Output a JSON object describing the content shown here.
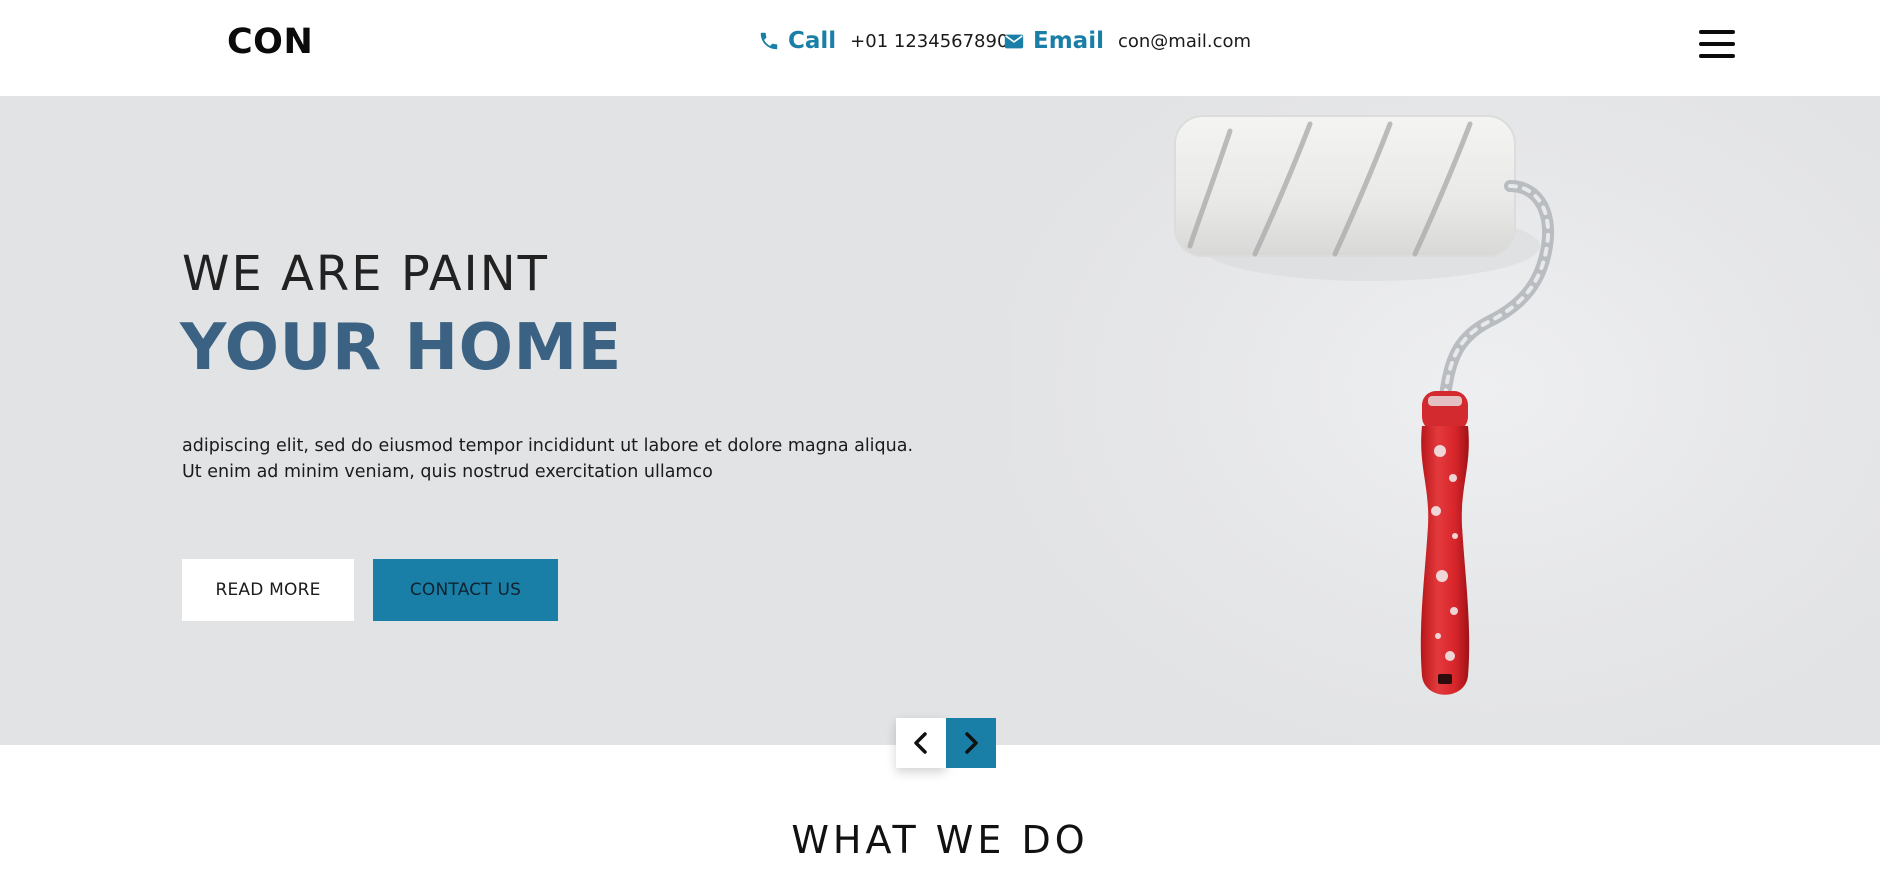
{
  "header": {
    "logo": "CON",
    "call_label": "Call",
    "call_value": "+01 1234567890",
    "email_label": "Email",
    "email_value": "con@mail.com",
    "icons": {
      "call": "phone-icon",
      "email": "envelope-icon",
      "menu": "hamburger-menu-icon"
    }
  },
  "hero": {
    "title_line1": "WE ARE PAINT",
    "title_line2": "YOUR HOME",
    "text_line1": "adipiscing elit, sed do eiusmod tempor incididunt ut labore et dolore magna aliqua.",
    "text_line2": "Ut enim ad minim veniam, quis nostrud exercitation ullamco",
    "read_more": "READ MORE",
    "contact_us": "CONTACT US",
    "image": "paint-roller-image"
  },
  "slider": {
    "prev_icon": "chevron-left-icon",
    "next_icon": "chevron-right-icon"
  },
  "section": {
    "title": "WHAT WE DO"
  },
  "colors": {
    "accent": "#1a7fa6",
    "title_blue": "#3b6283",
    "hero_bg": "#e2e3e5"
  }
}
